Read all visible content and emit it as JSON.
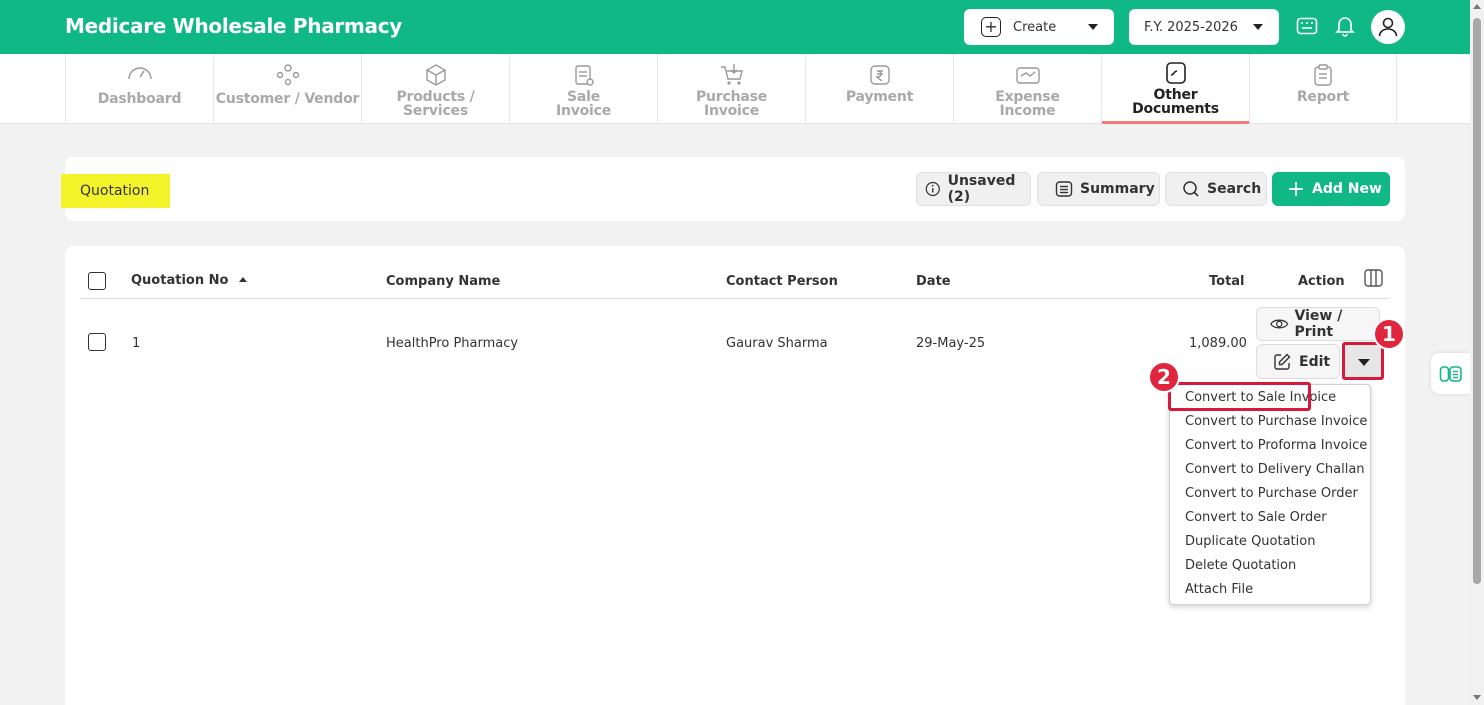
{
  "app": {
    "title": "Medicare Wholesale Pharmacy"
  },
  "topbar": {
    "create_label": "Create",
    "fy_label": "F.Y. 2025-2026",
    "icons": [
      "keyboard-icon",
      "bell-icon",
      "user-avatar-icon"
    ]
  },
  "nav": {
    "items": [
      {
        "label1": "Dashboard",
        "label2": "",
        "icon": "speedometer-icon"
      },
      {
        "label1": "Customer / Vendor",
        "label2": "",
        "icon": "users-icon"
      },
      {
        "label1": "Products / Services",
        "label2": "",
        "icon": "box-icon"
      },
      {
        "label1": "Sale",
        "label2": "Invoice",
        "icon": "sale-invoice-icon"
      },
      {
        "label1": "Purchase",
        "label2": "Invoice",
        "icon": "cart-icon"
      },
      {
        "label1": "Payment",
        "label2": "",
        "icon": "rupee-icon"
      },
      {
        "label1": "Expense",
        "label2": "Income",
        "icon": "expense-income-icon"
      },
      {
        "label1": "Other",
        "label2": "Documents",
        "icon": "document-icon",
        "active": true
      },
      {
        "label1": "Report",
        "label2": "",
        "icon": "report-icon"
      }
    ]
  },
  "page": {
    "title": "Quotation",
    "toolbar": {
      "unsaved_label": "Unsaved (2)",
      "summary_label": "Summary",
      "search_label": "Search",
      "add_label": "Add New"
    }
  },
  "table": {
    "headers": {
      "quotation_no": "Quotation No",
      "company": "Company Name",
      "contact": "Contact Person",
      "date": "Date",
      "total": "Total",
      "action": "Action"
    },
    "rows": [
      {
        "quotation_no": "1",
        "company": "HealthPro Pharmacy",
        "contact": "Gaurav Sharma",
        "date": "29-May-25",
        "total": "1,089.00"
      }
    ],
    "row_actions": {
      "view_label": "View / Print",
      "edit_label": "Edit"
    }
  },
  "dropdown": {
    "items": [
      "Convert to Sale Invoice",
      "Convert to Purchase Invoice",
      "Convert to Proforma Invoice",
      "Convert to Delivery Challan",
      "Convert to Purchase Order",
      "Convert to Sale Order",
      "Duplicate Quotation",
      "Delete Quotation",
      "Attach File"
    ]
  },
  "annotations": {
    "step1": "1",
    "step2": "2"
  },
  "colors": {
    "brand": "#10b886",
    "highlight": "#f3f32a",
    "annotation": "#d7193c",
    "active_underline": "#f07a7a"
  }
}
